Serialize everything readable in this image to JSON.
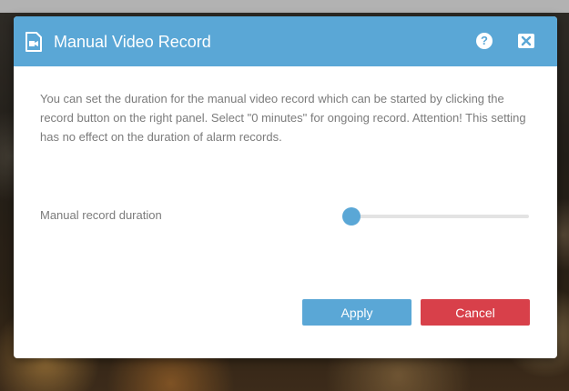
{
  "dialog": {
    "title": "Manual Video Record",
    "description": "You can set the duration for the manual video record which can be started by clicking the record button on the right panel. Select \"0 minutes\" for ongoing record. Attention! This setting has no effect on the duration of alarm records.",
    "help_label": "?",
    "setting": {
      "label": "Manual record duration",
      "slider_value_fraction": 0
    },
    "buttons": {
      "apply": "Apply",
      "cancel": "Cancel"
    }
  },
  "colors": {
    "accent": "#5aa7d6",
    "danger": "#d8404a",
    "text": "#7b7b7b"
  },
  "icons": {
    "header": "video-file-icon",
    "help": "help-icon",
    "close": "close-icon"
  }
}
